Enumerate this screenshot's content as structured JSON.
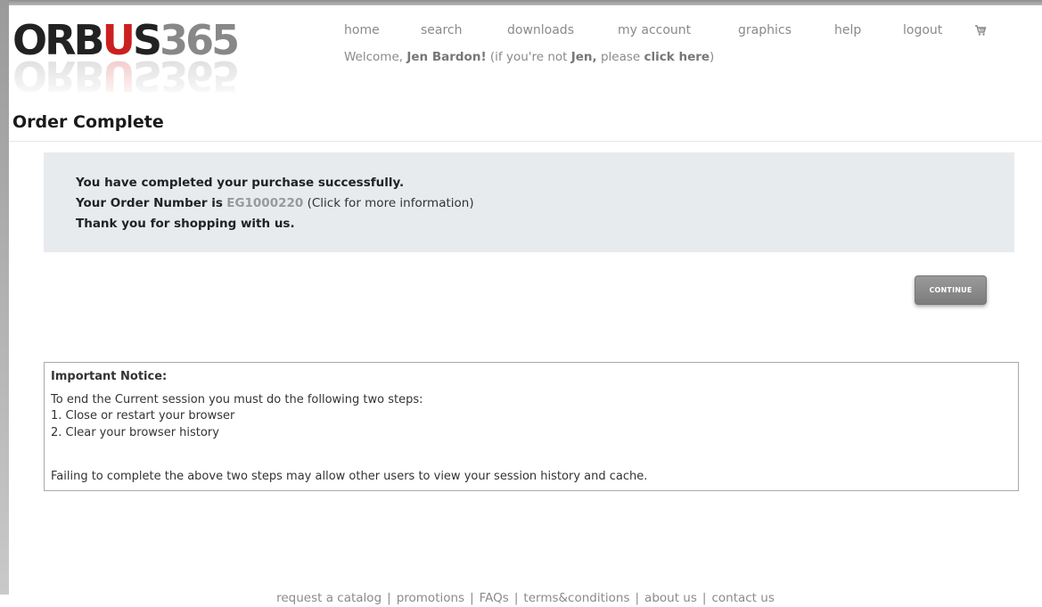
{
  "logo": {
    "prefix": "ORBUS",
    "dot_char": "U",
    "pre_dot": "ORB",
    "post_dot": "S",
    "number": "365"
  },
  "nav": {
    "home": "home",
    "search": "search",
    "downloads": "downloads",
    "my_account": "my account",
    "graphics": "graphics",
    "help": "help",
    "logout": "logout",
    "cart_icon": "cart-icon"
  },
  "welcome": {
    "prefix": "Welcome,",
    "name": "Jen Bardon!",
    "middle": "(if you're not",
    "first_name": "Jen,",
    "please": "please",
    "link": "click here",
    "suffix": ")"
  },
  "page_title": "Order Complete",
  "confirmation": {
    "line1": "You have completed your purchase successfully.",
    "order_label": "Your Order Number is",
    "order_number": "EG1000220",
    "order_hint": "(Click for more information)",
    "line3": "Thank you for shopping with us."
  },
  "continue_label": "CONTINUE",
  "notice": {
    "title": "Important Notice:",
    "intro": "To end the Current session you must do the following two steps:",
    "step1": "1. Close or restart your browser",
    "step2": "2. Clear your browser history",
    "warning": "Failing to complete the above two steps may allow other users to view your session history and cache."
  },
  "footer": {
    "links": [
      "request a catalog",
      "promotions",
      "FAQs",
      "terms&conditions",
      "about us",
      "contact us"
    ],
    "separator": "|"
  },
  "colors": {
    "nav_text": "#8a8a8a",
    "panel_bg": "#e8ebee",
    "order_number": "#999999",
    "logo_dot": "#cc1f1f",
    "button": "#8a8a8a"
  }
}
